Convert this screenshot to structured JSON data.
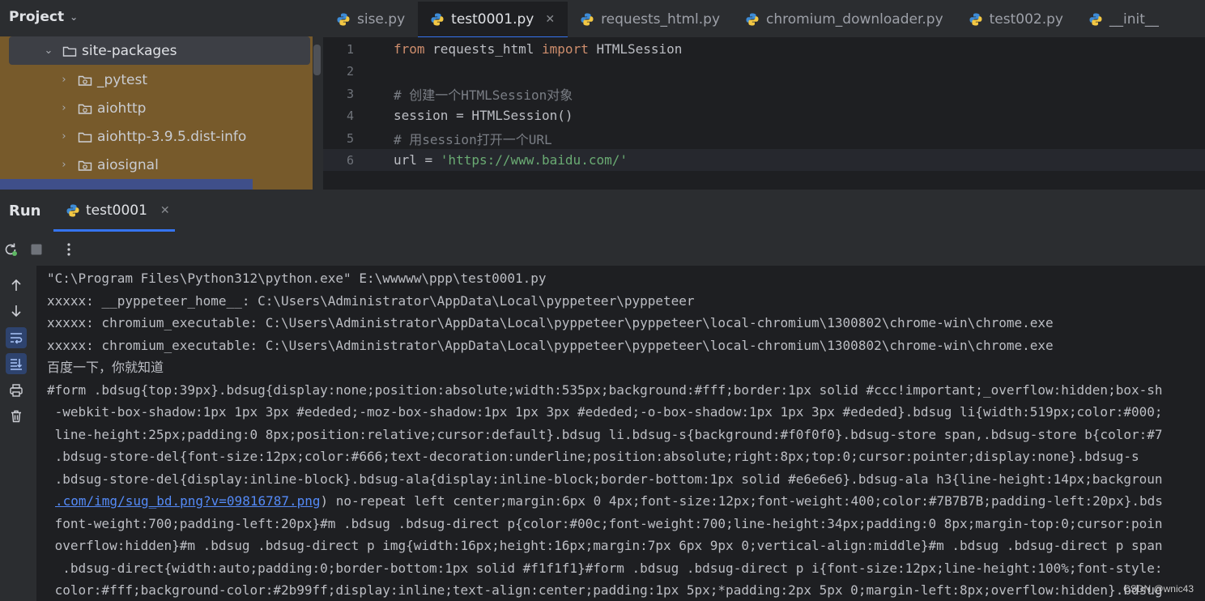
{
  "project": {
    "title": "Project",
    "tree": [
      {
        "label": "site-packages",
        "expanded": true
      },
      {
        "label": "_pytest"
      },
      {
        "label": "aiohttp"
      },
      {
        "label": "aiohttp-3.9.5.dist-info"
      },
      {
        "label": "aiosignal"
      }
    ]
  },
  "tabs": [
    {
      "label": "sise.py"
    },
    {
      "label": "test0001.py",
      "active": true
    },
    {
      "label": "requests_html.py"
    },
    {
      "label": "chromium_downloader.py"
    },
    {
      "label": "test002.py"
    },
    {
      "label": "__init__"
    }
  ],
  "editor": {
    "line_numbers": [
      "1",
      "2",
      "3",
      "4",
      "5",
      "6"
    ],
    "lines": {
      "l1_kw1": "from",
      "l1_mid": " requests_html ",
      "l1_kw2": "import",
      "l1_end": " HTMLSession",
      "l3": "# 创建一个HTMLSession对象",
      "l4": "session = HTMLSession()",
      "l5": "# 用session打开一个URL",
      "l6_start": "url = ",
      "l6_str": "'https://www.baidu.com/'"
    }
  },
  "run": {
    "title": "Run",
    "tab_label": "test0001"
  },
  "console": {
    "lines": [
      "\"C:\\Program Files\\Python312\\python.exe\" E:\\wwwww\\ppp\\test0001.py",
      "xxxxx: __pyppeteer_home__: C:\\Users\\Administrator\\AppData\\Local\\pyppeteer\\pyppeteer",
      "xxxxx: chromium_executable: C:\\Users\\Administrator\\AppData\\Local\\pyppeteer\\pyppeteer\\local-chromium\\1300802\\chrome-win\\chrome.exe",
      "xxxxx: chromium_executable: C:\\Users\\Administrator\\AppData\\Local\\pyppeteer\\pyppeteer\\local-chromium\\1300802\\chrome-win\\chrome.exe",
      "百度一下，你就知道",
      "#form .bdsug{top:39px}.bdsug{display:none;position:absolute;width:535px;background:#fff;border:1px solid #ccc!important;_overflow:hidden;box-sh",
      " -webkit-box-shadow:1px 1px 3px #ededed;-moz-box-shadow:1px 1px 3px #ededed;-o-box-shadow:1px 1px 3px #ededed}.bdsug li{width:519px;color:#000;",
      " line-height:25px;padding:0 8px;position:relative;cursor:default}.bdsug li.bdsug-s{background:#f0f0f0}.bdsug-store span,.bdsug-store b{color:#7",
      " .bdsug-store-del{font-size:12px;color:#666;text-decoration:underline;position:absolute;right:8px;top:0;cursor:pointer;display:none}.bdsug-s",
      " .bdsug-store-del{display:inline-block}.bdsug-ala{display:inline-block;border-bottom:1px solid #e6e6e6}.bdsug-ala h3{line-height:14px;backgroun"
    ],
    "link_line": {
      "link": ".com/img/sug_bd.png?v=09816787.png",
      "rest": ") no-repeat left center;margin:6px 0 4px;font-size:12px;font-weight:400;color:#7B7B7B;padding-left:20px}.bds"
    },
    "tail_lines": [
      " font-weight:700;padding-left:20px}#m .bdsug .bdsug-direct p{color:#00c;font-weight:700;line-height:34px;padding:0 8px;margin-top:0;cursor:poin",
      " overflow:hidden}#m .bdsug .bdsug-direct p img{width:16px;height:16px;margin:7px 6px 9px 0;vertical-align:middle}#m .bdsug .bdsug-direct p span",
      "  .bdsug-direct{width:auto;padding:0;border-bottom:1px solid #f1f1f1}#form .bdsug .bdsug-direct p i{font-size:12px;line-height:100%;font-style:",
      " color:#fff;background-color:#2b99ff;display:inline;text-align:center;padding:1px 5px;*padding:2px 5px 0;margin-left:8px;overflow:hidden}.bdsug"
    ]
  },
  "watermark": "CSDN @wnic43"
}
